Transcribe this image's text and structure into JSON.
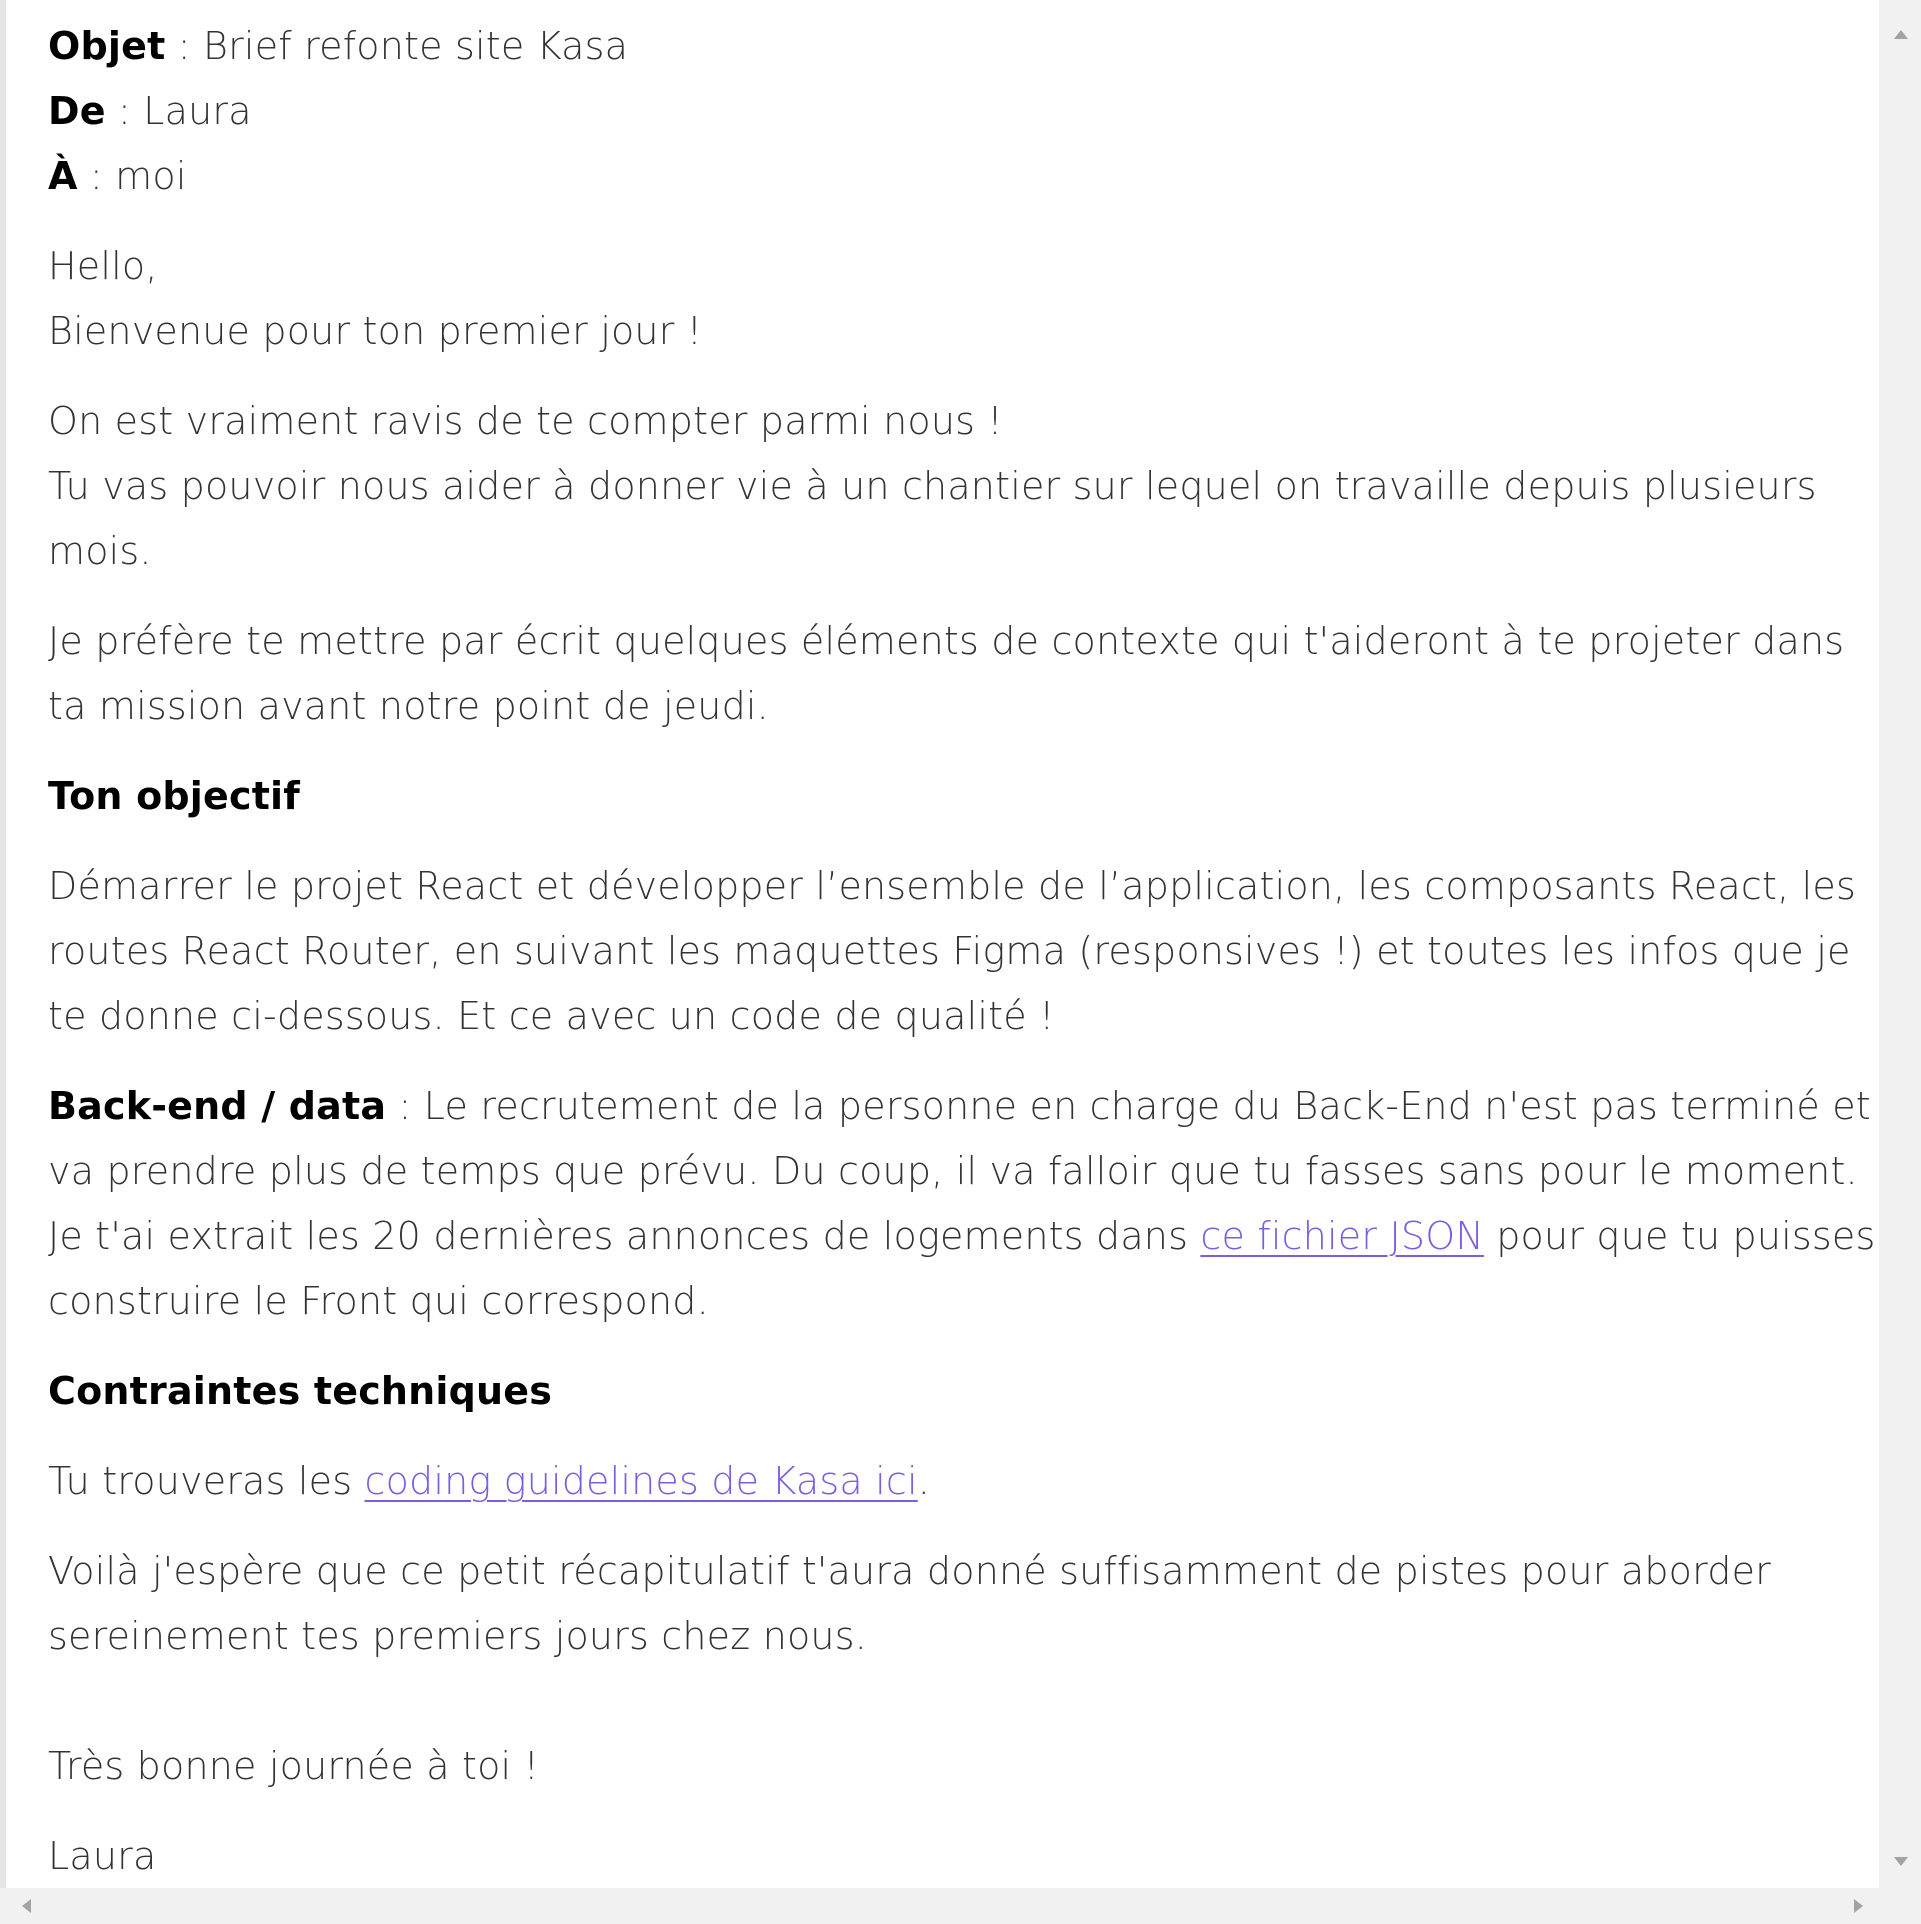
{
  "header": {
    "subject_label": "Objet",
    "subject_value": " : Brief refonte site Kasa",
    "from_label": "De",
    "from_value": " : Laura",
    "to_label": "À",
    "to_value": " : moi"
  },
  "body": {
    "greeting_1": "Hello,",
    "greeting_2": "Bienvenue pour ton premier jour !",
    "intro_1": "On est vraiment ravis de te compter parmi nous !",
    "intro_2": "Tu vas pouvoir nous aider à donner vie à un chantier sur lequel on travaille depuis plusieurs mois.",
    "context": "Je préfère te mettre par écrit quelques éléments de contexte qui t'aideront à te projeter dans ta mission avant notre point de jeudi.",
    "objective_heading": "Ton objectif",
    "objective_text": "Démarrer le projet React et développer l’ensemble de l’application, les composants React, les routes React Router, en suivant les maquettes Figma (responsives !) et toutes les infos que je te donne ci-dessous. Et ce avec un code de qualité !",
    "backend_label": "Back-end / data",
    "backend_text_1": " : Le recrutement de la personne en charge du Back-End n'est pas terminé et va prendre plus de temps que prévu. Du coup, il va falloir que tu fasses sans pour le moment. Je t'ai extrait les 20 dernières annonces de logements dans ",
    "backend_link": "ce fichier JSON",
    "backend_text_2": " pour que tu puisses construire le Front qui correspond.",
    "constraints_heading": "Contraintes techniques",
    "guidelines_text_1": "Tu trouveras les ",
    "guidelines_link": "coding guidelines de Kasa ici",
    "guidelines_text_2": ".",
    "closing": "Voilà j'espère que ce petit récapitulatif t'aura donné suffisamment de pistes pour aborder sereinement tes premiers jours chez nous.",
    "farewell": "Très bonne journée à toi !",
    "signature": "Laura"
  },
  "colors": {
    "link": "#7c5ce0",
    "text": "#333333",
    "bold": "#000000",
    "scrollbar": "#f1f1f1"
  }
}
